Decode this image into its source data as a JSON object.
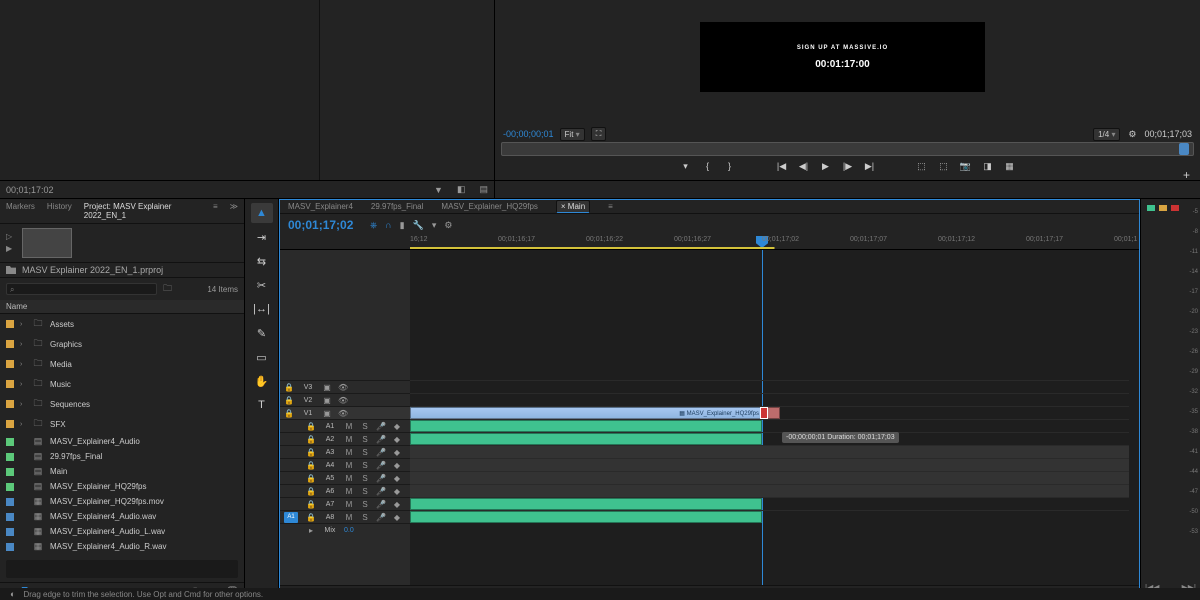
{
  "program": {
    "preview_text": "SIGN UP AT MASSIVE.IO",
    "preview_tc": "00:01:17:00",
    "in_tc": "-00;00;00;01",
    "mode": "Fit",
    "zoom": "1/4",
    "out_tc": "00;01;17;03"
  },
  "source": {
    "tc": "00;01;17:02"
  },
  "panel_tabs": {
    "markers": "Markers",
    "history": "History",
    "project": "Project: MASV Explainer 2022_EN_1"
  },
  "project": {
    "file": "MASV Explainer 2022_EN_1.prproj",
    "items_label": "14 Items",
    "name_col": "Name",
    "bins": [
      {
        "name": "Assets",
        "color": "c-orange",
        "type": "folder"
      },
      {
        "name": "Graphics",
        "color": "c-orange",
        "type": "folder"
      },
      {
        "name": "Media",
        "color": "c-orange",
        "type": "folder"
      },
      {
        "name": "Music",
        "color": "c-orange",
        "type": "folder"
      },
      {
        "name": "Sequences",
        "color": "c-orange",
        "type": "folder"
      },
      {
        "name": "SFX",
        "color": "c-orange",
        "type": "folder"
      },
      {
        "name": "MASV_Explainer4_Audio",
        "color": "c-green",
        "type": "seq"
      },
      {
        "name": "29.97fps_Final",
        "color": "c-green",
        "type": "seq"
      },
      {
        "name": "Main",
        "color": "c-green",
        "type": "seq"
      },
      {
        "name": "MASV_Explainer_HQ29fps",
        "color": "c-green",
        "type": "seq"
      },
      {
        "name": "MASV_Explainer_HQ29fps.mov",
        "color": "c-blue",
        "type": "media"
      },
      {
        "name": "MASV_Explainer4_Audio.wav",
        "color": "c-blue",
        "type": "media"
      },
      {
        "name": "MASV_Explainer4_Audio_L.wav",
        "color": "c-blue",
        "type": "media"
      },
      {
        "name": "MASV_Explainer4_Audio_R.wav",
        "color": "c-blue",
        "type": "media"
      }
    ]
  },
  "timeline": {
    "tabs": [
      "MASV_Explainer4",
      "29.97fps_Final",
      "MASV_Explainer_HQ29fps",
      "Main"
    ],
    "active_tab": 3,
    "timecode": "00;01;17;02",
    "ruler": [
      "16;12",
      "00;01;16;17",
      "00;01;16;22",
      "00;01;16;27",
      "00;01;17;02",
      "00;01;17;07",
      "00;01;17;12",
      "00;01;17;17",
      "00;01;1"
    ],
    "video_tracks": [
      "V3",
      "V2",
      "V1"
    ],
    "audio_tracks": [
      "A1",
      "A2",
      "A3",
      "A4",
      "A5",
      "A6",
      "A7",
      "A8"
    ],
    "mix": "Mix",
    "mix_val": "0.0",
    "clip_label": "MASV_Explainer_HQ29fps",
    "tooltip": "-00;00;00;01 Duration: 00;01;17;03"
  },
  "meters": {
    "marks": [
      "-5",
      "-8",
      "-11",
      "-14",
      "-17",
      "-20",
      "-23",
      "-26",
      "-29",
      "-32",
      "-35",
      "-38",
      "-41",
      "-44",
      "-47",
      "-50",
      "-53"
    ]
  },
  "status": "Drag edge to trim the selection. Use Opt and Cmd for other options."
}
